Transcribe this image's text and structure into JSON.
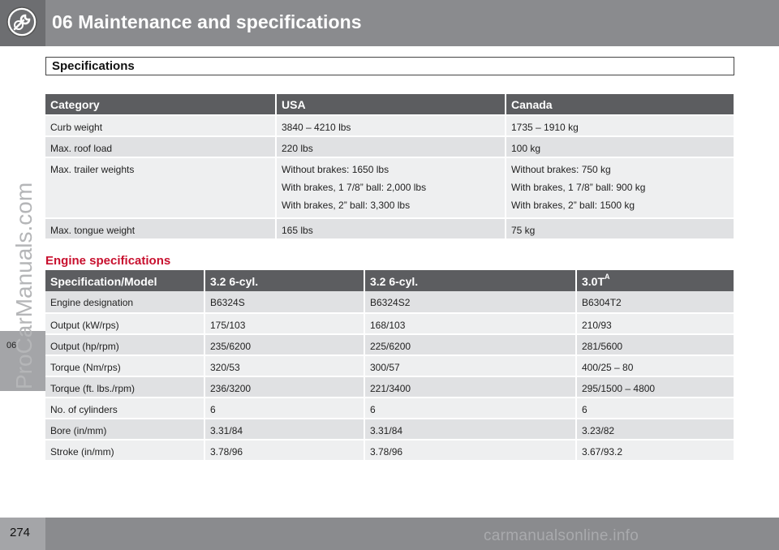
{
  "header": {
    "title": "06 Maintenance and specifications",
    "icon": "wrench-gear-icon"
  },
  "gutter": {
    "chapter_tab": "06",
    "watermark": "ProCarManuals.com"
  },
  "footer": {
    "page_number": "274",
    "watermark": "carmanualsonline.info"
  },
  "section": {
    "title": "Specifications"
  },
  "weights_table": {
    "headers": [
      "Category",
      "USA",
      "Canada"
    ],
    "rows": [
      {
        "category": "Curb weight",
        "usa": "3840 – 4210 lbs",
        "canada": "1735 – 1910 kg"
      },
      {
        "category": "Max. roof load",
        "usa": "220 lbs",
        "canada": "100 kg"
      },
      {
        "category": "Max. trailer weights",
        "usa_lines": [
          "Without brakes: 1650 lbs",
          "With brakes, 1 7/8” ball: 2,000 lbs",
          "With brakes, 2” ball: 3,300 lbs"
        ],
        "canada_lines": [
          "Without brakes: 750 kg",
          "With brakes, 1 7/8” ball: 900 kg",
          "With brakes, 2” ball: 1500 kg"
        ]
      },
      {
        "category": "Max. tongue weight",
        "usa": "165 lbs",
        "canada": "75 kg"
      }
    ]
  },
  "engine": {
    "heading": "Engine specifications",
    "headers": [
      "Specification/Model",
      "3.2 6-cyl.",
      "3.2 6-cyl.",
      "3.0T"
    ],
    "header_footnote": "A",
    "rows": [
      [
        "Engine designation",
        "B6324S",
        "B6324S2",
        "B6304T2"
      ],
      [
        "Output (kW/rps)",
        "175/103",
        "168/103",
        "210/93"
      ],
      [
        "Output (hp/rpm)",
        "235/6200",
        "225/6200",
        "281/5600"
      ],
      [
        "Torque (Nm/rps)",
        "320/53",
        "300/57",
        "400/25 – 80"
      ],
      [
        "Torque (ft. lbs./rpm)",
        "236/3200",
        "221/3400",
        "295/1500 – 4800"
      ],
      [
        "No. of cylinders",
        "6",
        "6",
        "6"
      ],
      [
        "Bore (in/mm)",
        "3.31/84",
        "3.31/84",
        "3.23/82"
      ],
      [
        "Stroke (in/mm)",
        "3.78/96",
        "3.78/96",
        "3.67/93.2"
      ]
    ]
  }
}
